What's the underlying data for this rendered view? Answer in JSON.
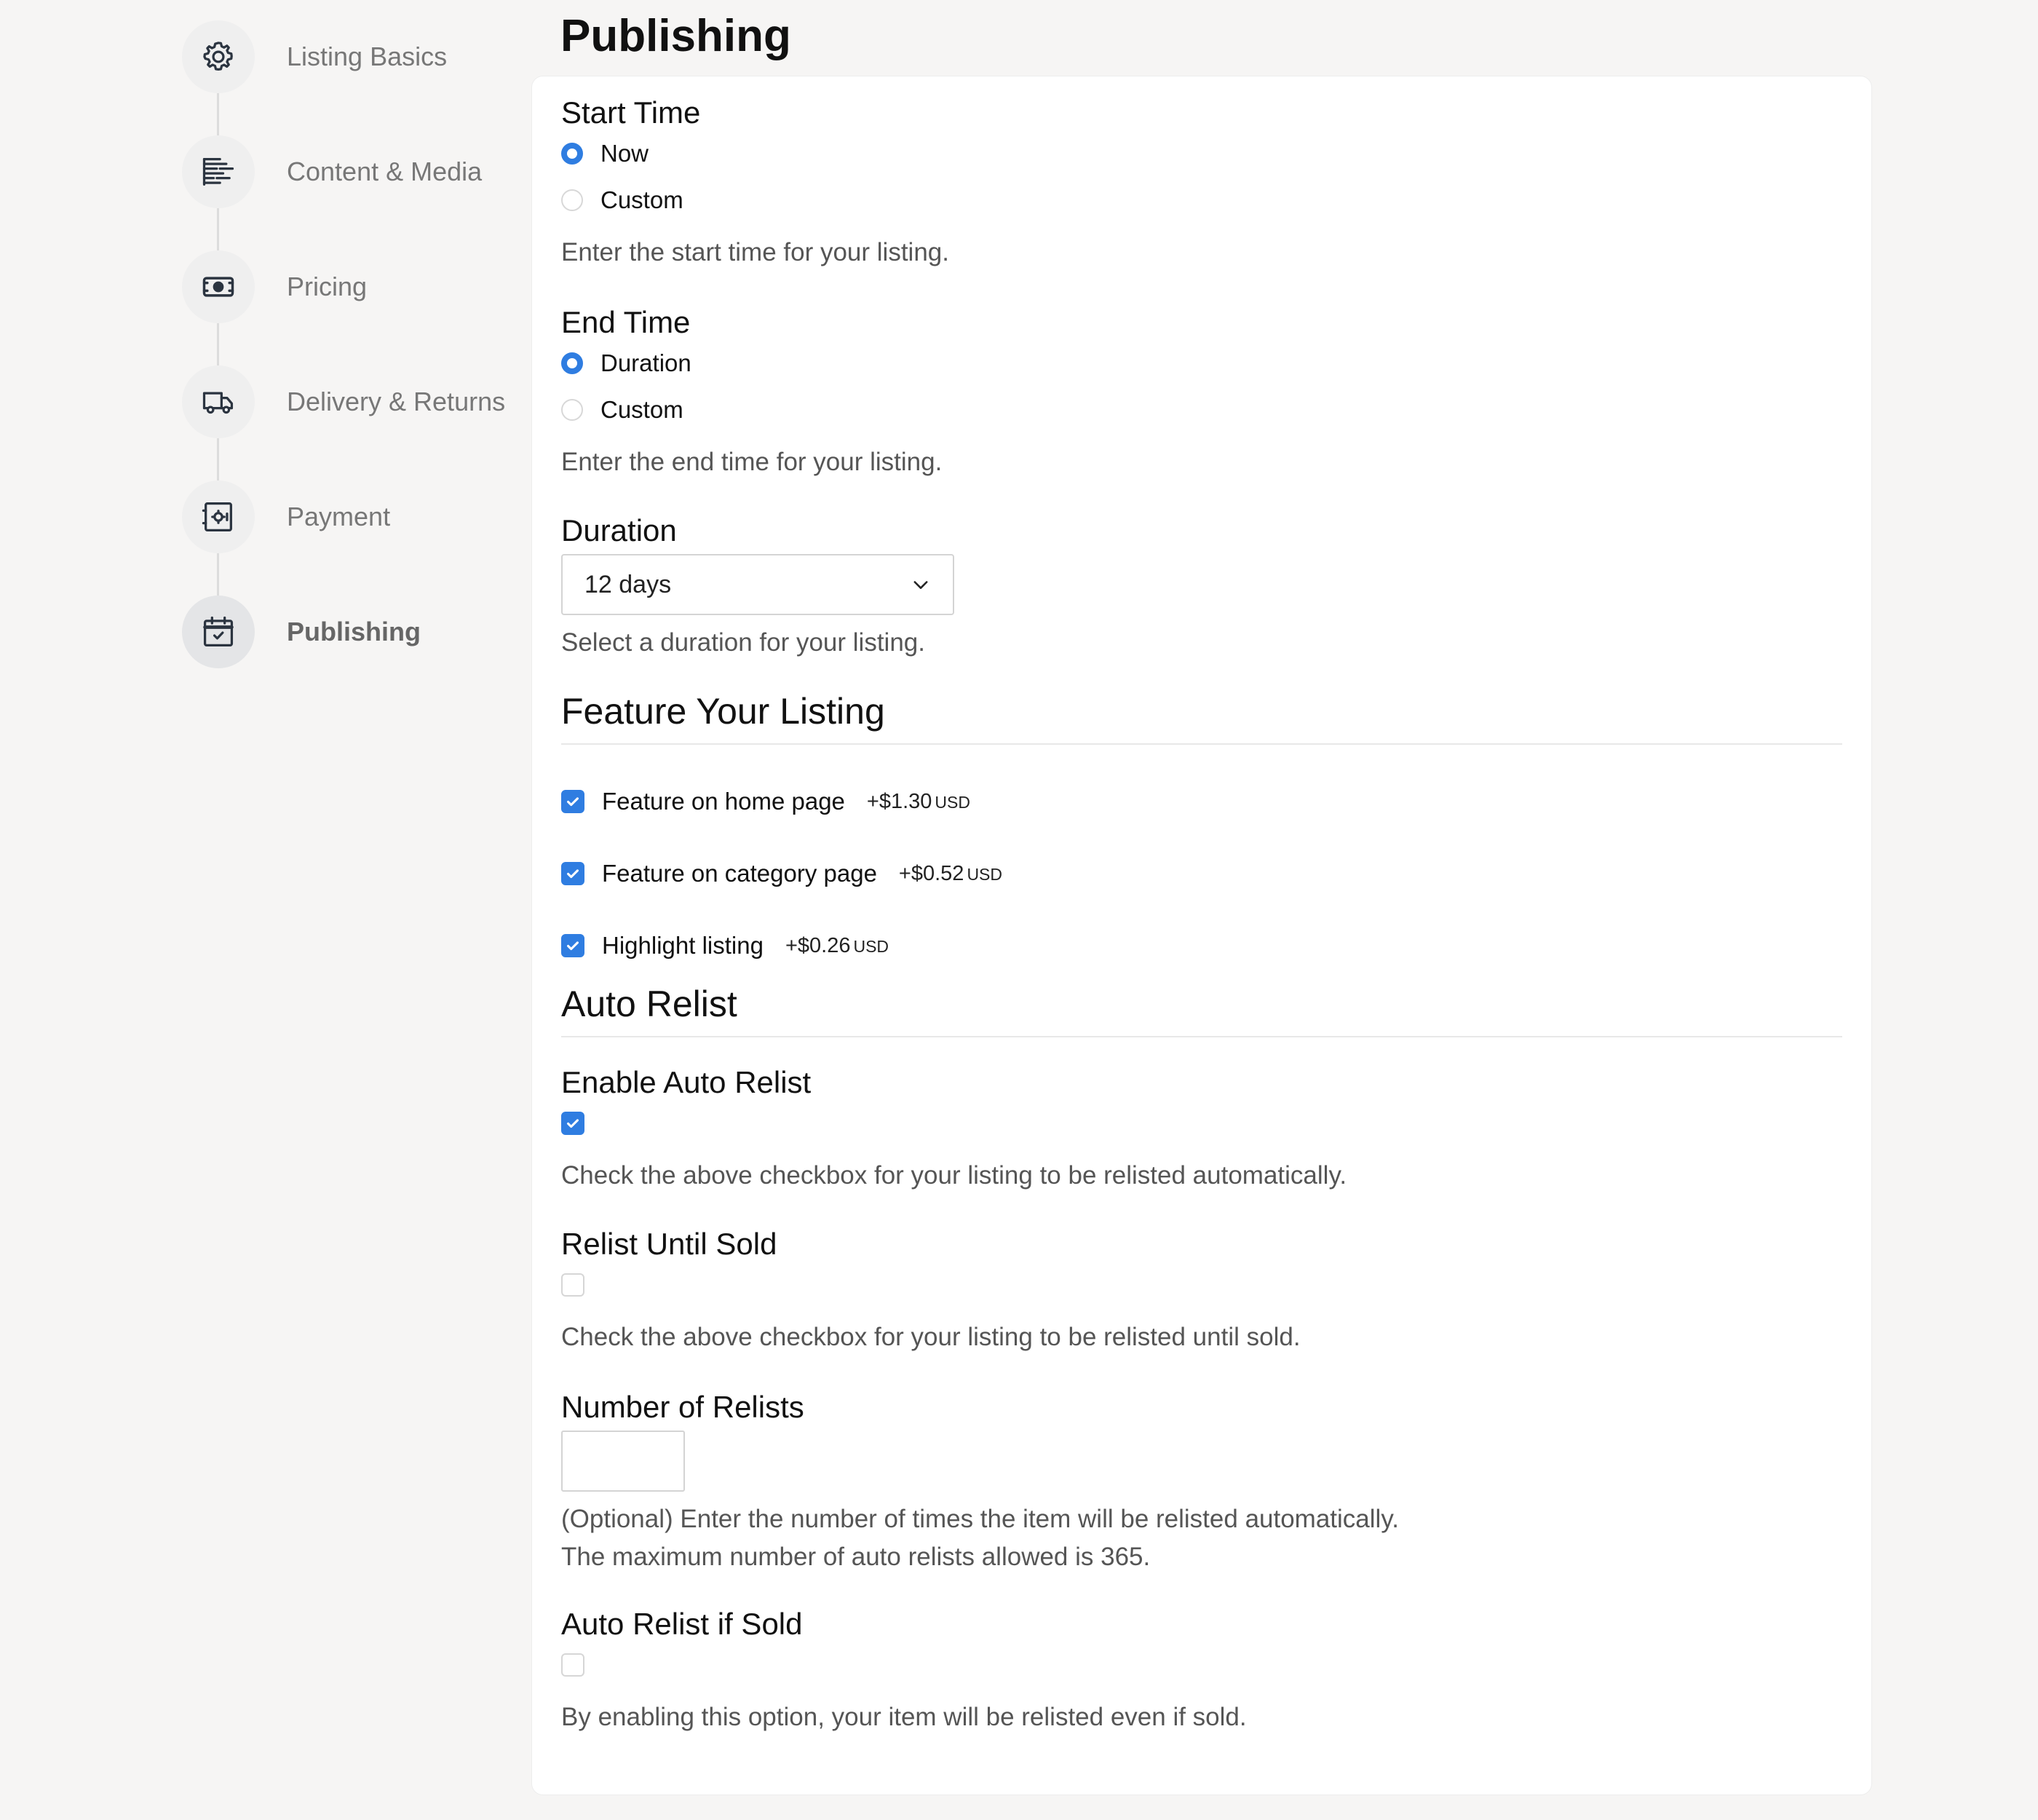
{
  "sidebar": {
    "steps": [
      {
        "label": "Listing Basics",
        "icon": "gear-icon"
      },
      {
        "label": "Content & Media",
        "icon": "text-lines-icon"
      },
      {
        "label": "Pricing",
        "icon": "banknote-icon"
      },
      {
        "label": "Delivery & Returns",
        "icon": "truck-icon"
      },
      {
        "label": "Payment",
        "icon": "safe-icon"
      },
      {
        "label": "Publishing",
        "icon": "calendar-check-icon",
        "active": true
      }
    ]
  },
  "page": {
    "title": "Publishing"
  },
  "start_time": {
    "label": "Start Time",
    "options": [
      "Now",
      "Custom"
    ],
    "selected": "Now",
    "help": "Enter the start time for your listing."
  },
  "end_time": {
    "label": "End Time",
    "options": [
      "Duration",
      "Custom"
    ],
    "selected": "Duration",
    "help": "Enter the end time for your listing."
  },
  "duration": {
    "label": "Duration",
    "value": "12 days",
    "help": "Select a duration for your listing."
  },
  "feature": {
    "title": "Feature Your Listing",
    "options": [
      {
        "label": "Feature on home page",
        "price": "+$1.30",
        "currency": "USD",
        "checked": true
      },
      {
        "label": "Feature on category page",
        "price": "+$0.52",
        "currency": "USD",
        "checked": true
      },
      {
        "label": "Highlight listing",
        "price": "+$0.26",
        "currency": "USD",
        "checked": true
      }
    ]
  },
  "auto_relist": {
    "title": "Auto Relist",
    "enable": {
      "label": "Enable Auto Relist",
      "checked": true,
      "help": "Check the above checkbox for your listing to be relisted automatically."
    },
    "until_sold": {
      "label": "Relist Until Sold",
      "checked": false,
      "help": "Check the above checkbox for your listing to be relisted until sold."
    },
    "number": {
      "label": "Number of Relists",
      "value": "",
      "help1": "(Optional) Enter the number of times the item will be relisted automatically.",
      "help2": "The maximum number of auto relists allowed is 365."
    },
    "if_sold": {
      "label": "Auto Relist if Sold",
      "checked": false,
      "help": "By enabling this option, your item will be relisted even if sold."
    }
  },
  "colors": {
    "accent": "#2f7de1",
    "background": "#f6f5f4",
    "card": "#ffffff"
  }
}
